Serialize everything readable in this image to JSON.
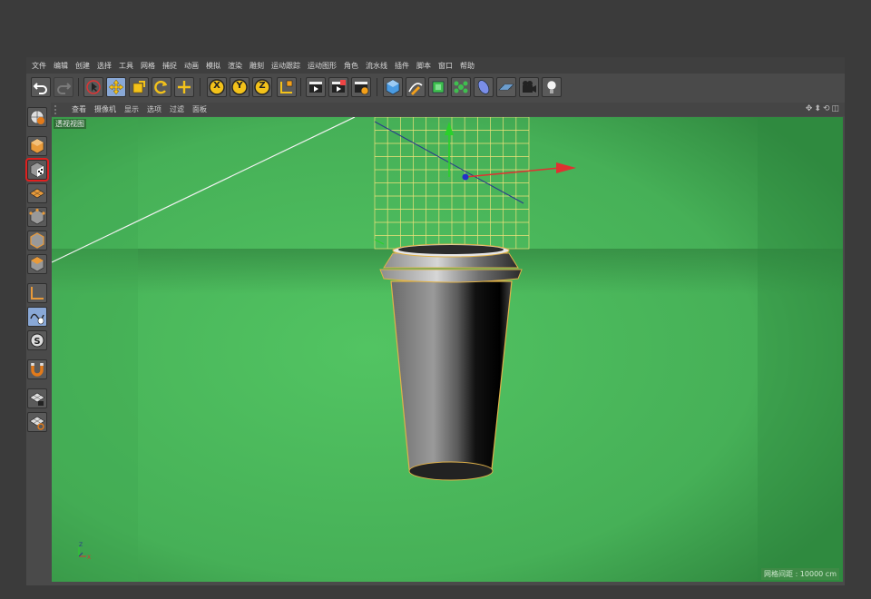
{
  "menu": [
    "文件",
    "编辑",
    "创建",
    "选择",
    "工具",
    "网格",
    "捕捉",
    "动画",
    "模拟",
    "渲染",
    "雕刻",
    "运动跟踪",
    "运动图形",
    "角色",
    "流水线",
    "插件",
    "脚本",
    "窗口",
    "帮助"
  ],
  "viewport_menu": [
    "查看",
    "摄像机",
    "显示",
    "选项",
    "过滤",
    "面板"
  ],
  "viewport": {
    "label": "透视视图",
    "grid_distance": "网格间距 : 10000 cm"
  },
  "axis_gizmo": {
    "z": "Z",
    "x": "X"
  },
  "toolbar": {
    "axis_x": "X",
    "axis_y": "Y",
    "axis_z": "Z"
  },
  "colors": {
    "viewport_green": "#4bb85c",
    "accent_blue": "#89a8d6",
    "highlight_red": "#e0201f",
    "grid_yellow": "#f0e27a"
  }
}
